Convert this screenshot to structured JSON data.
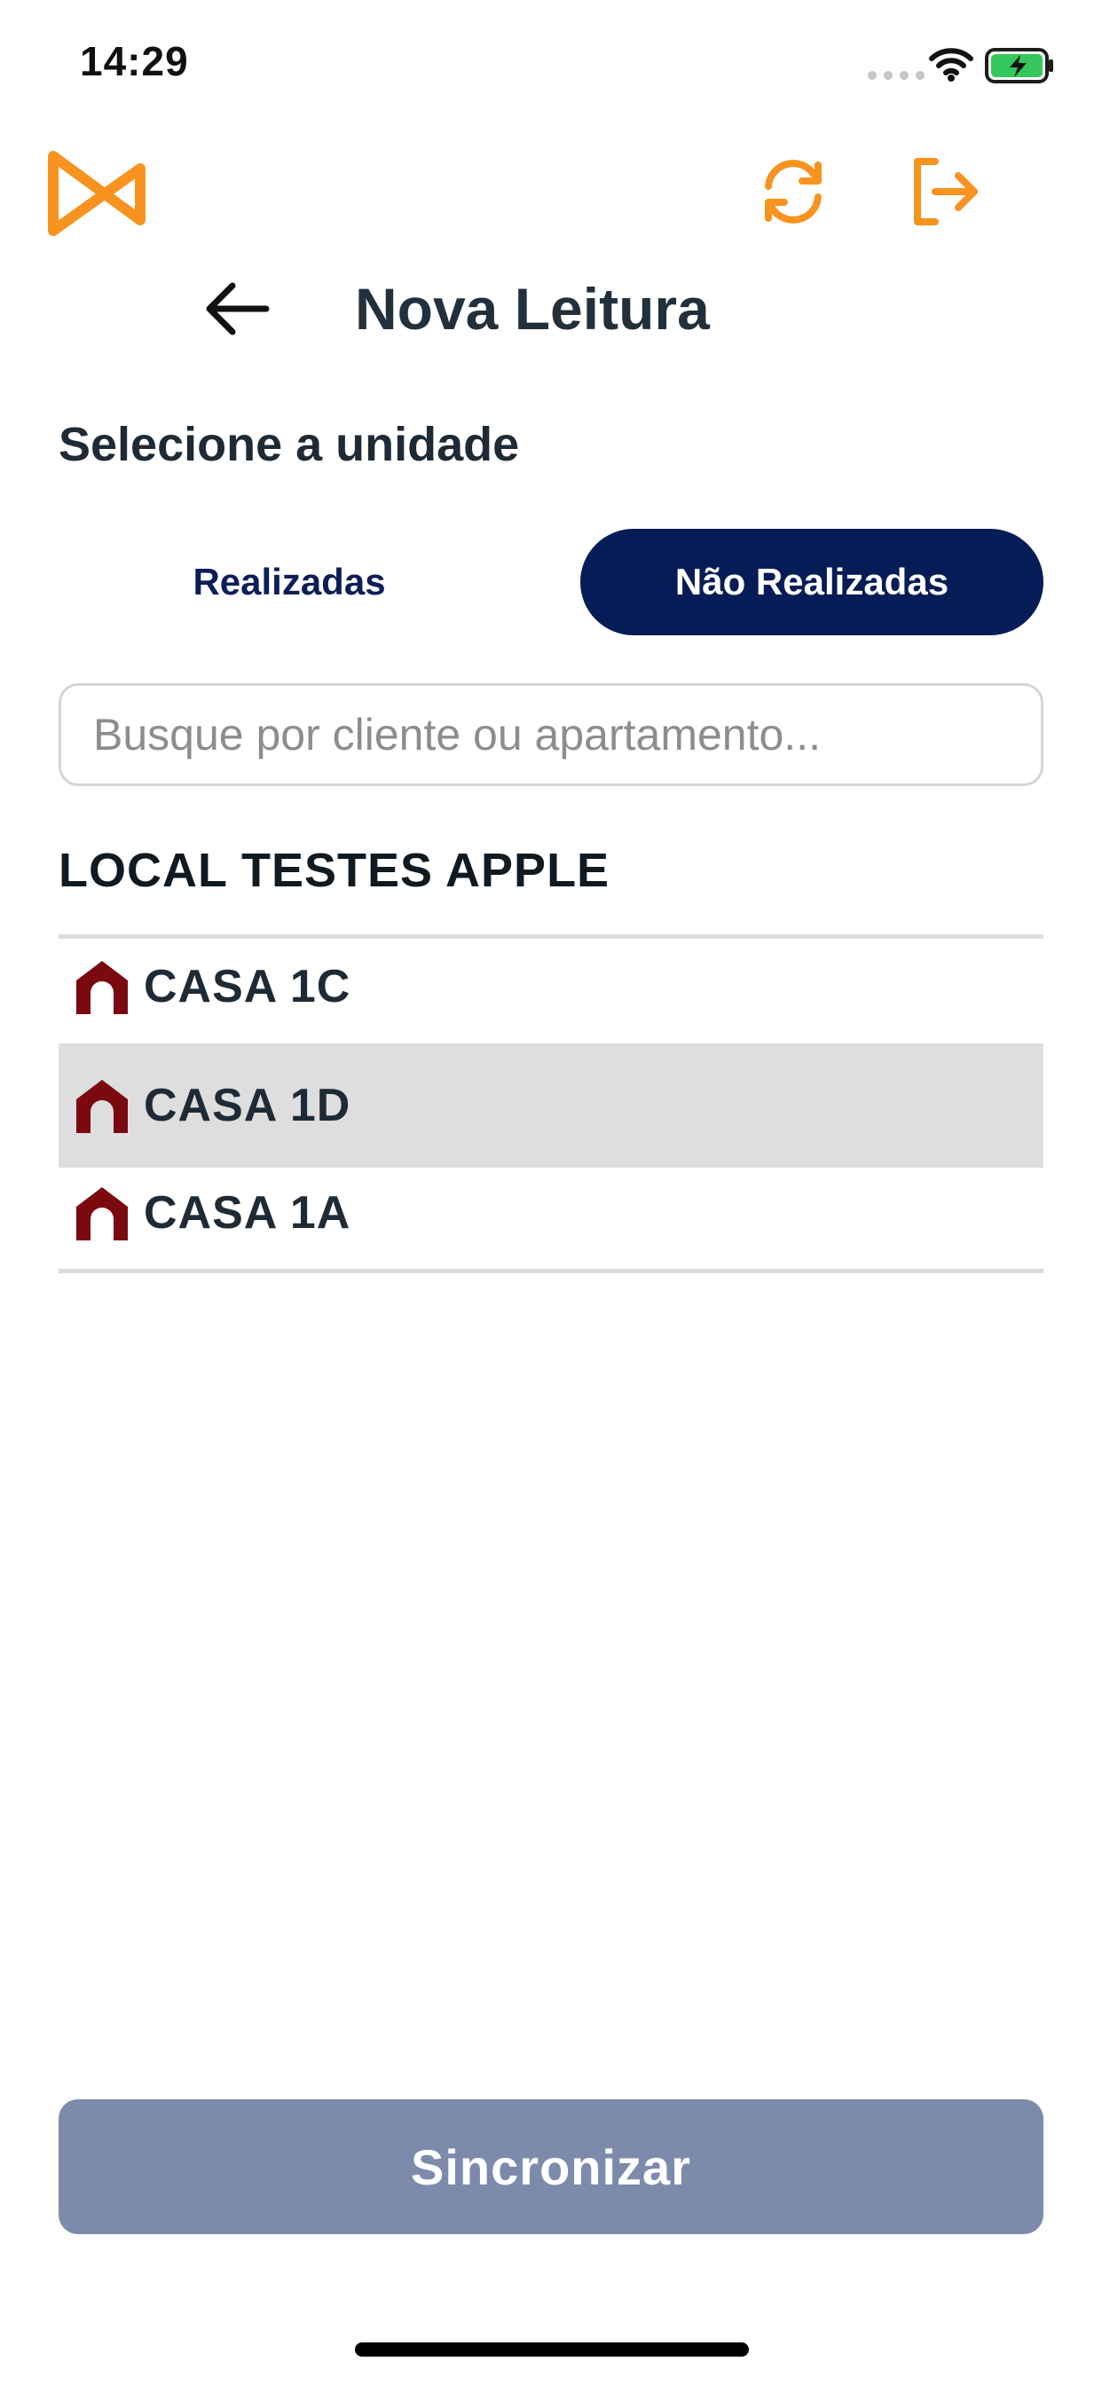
{
  "status_bar": {
    "time": "14:29"
  },
  "header": {
    "title": "Nova Leitura"
  },
  "section": {
    "heading": "Selecione a unidade"
  },
  "tabs": [
    {
      "label": "Realizadas",
      "active": false
    },
    {
      "label": "Não Realizadas",
      "active": true
    }
  ],
  "search": {
    "placeholder": "Busque por cliente ou apartamento...",
    "value": ""
  },
  "group": {
    "title": "LOCAL TESTES APPLE"
  },
  "units": [
    {
      "label": "CASA 1C",
      "icon": "house-icon",
      "selected": false
    },
    {
      "label": "CASA 1D",
      "icon": "house-icon",
      "selected": true
    },
    {
      "label": "CASA 1A",
      "icon": "house-icon",
      "selected": false
    }
  ],
  "footer": {
    "sync_label": "Sincronizar"
  },
  "colors": {
    "accent_orange": "#f7931e",
    "navy": "#061c56",
    "house_red": "#7a0a10",
    "button_disabled": "#7c8bab"
  }
}
